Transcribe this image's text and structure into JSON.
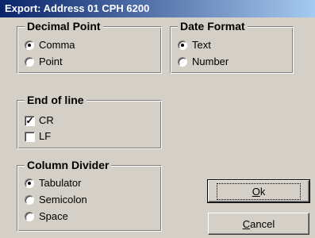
{
  "window": {
    "title": "Export: Address 01 CPH 6200"
  },
  "decimal_point": {
    "legend": "Decimal Point",
    "options": [
      {
        "label": "Comma",
        "checked": true
      },
      {
        "label": "Point",
        "checked": false
      }
    ]
  },
  "date_format": {
    "legend": "Date Format",
    "options": [
      {
        "label": "Text",
        "checked": true
      },
      {
        "label": "Number",
        "checked": false
      }
    ]
  },
  "end_of_line": {
    "legend": "End of line",
    "options": [
      {
        "label": "CR",
        "checked": true
      },
      {
        "label": "LF",
        "checked": false
      }
    ]
  },
  "column_divider": {
    "legend": "Column Divider",
    "options": [
      {
        "label": "Tabulator",
        "checked": true
      },
      {
        "label": "Semicolon",
        "checked": false
      },
      {
        "label": "Space",
        "checked": false
      }
    ]
  },
  "buttons": {
    "ok_mnemonic": "O",
    "ok_rest": "k",
    "cancel_mnemonic": "C",
    "cancel_rest": "ancel"
  }
}
